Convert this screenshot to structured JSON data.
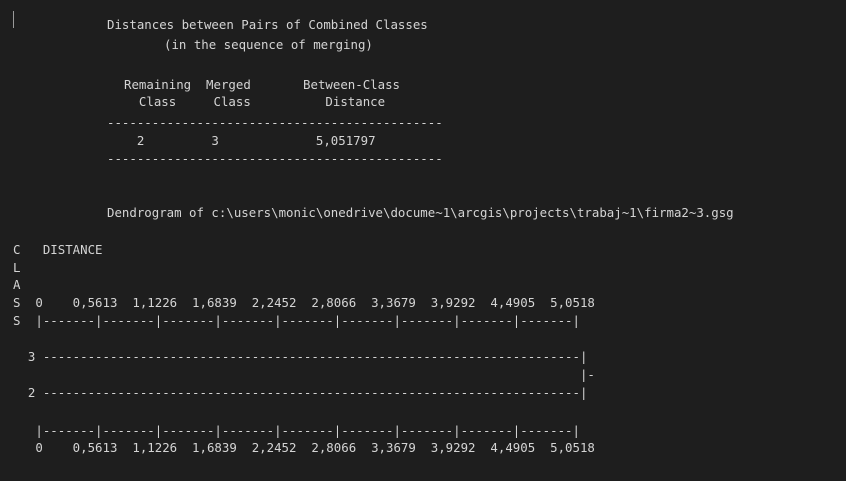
{
  "theme": {
    "background": "#1e1e1e",
    "text": "#d4d4d4",
    "cursor": "#9a9a9a"
  },
  "report": {
    "title_line1": "Distances between Pairs of Combined Classes",
    "title_line2": "(in the sequence of merging)",
    "header_row1": "Remaining  Merged       Between-Class",
    "header_row2": "  Class     Class          Distance",
    "rule_top": "---------------------------------------------",
    "data_row": "    2         3             5,051797",
    "rule_bottom": "---------------------------------------------",
    "dendrogram_title": "Dendrogram of c:\\users\\monic\\onedrive\\docume~1\\arcgis\\projects\\trabaj~1\\firma2~3.gsg"
  },
  "dendrogram": {
    "row_c": "C   DISTANCE",
    "row_l": "L",
    "row_a": "A",
    "row_s1": "S  0    0,5613  1,1226  1,6839  2,2452  2,8066  3,3679  3,9292  4,4905  5,0518",
    "row_s2": "S  |-------|-------|-------|-------|-------|-------|-------|-------|-------|",
    "row_3": "  3 ------------------------------------------------------------------------|",
    "row_dash": "                                                                            |-",
    "row_2": "  2 ------------------------------------------------------------------------|",
    "row_bottom_scale": "   |-------|-------|-------|-------|-------|-------|-------|-------|-------|",
    "row_bottom_numbers": "   0    0,5613  1,1226  1,6839  2,2452  2,8066  3,3679  3,9292  4,4905  5,0518"
  }
}
